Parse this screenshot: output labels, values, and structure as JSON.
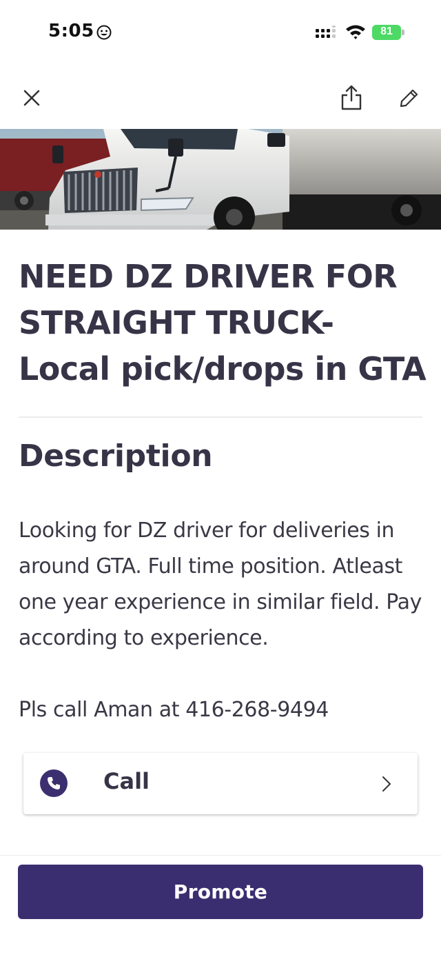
{
  "status_bar": {
    "time": "5:05",
    "battery_level": "81",
    "icons": [
      "emoji-face-icon",
      "cellular-signal-icon",
      "wifi-icon",
      "battery-charging-icon"
    ]
  },
  "nav": {
    "icons": [
      "close-icon",
      "share-icon",
      "edit-pencil-icon"
    ]
  },
  "listing": {
    "title": "NEED DZ DRIVER FOR STRAIGHT TRUCK- Local pick/drops in GTA",
    "description_heading": "Description",
    "description": "Looking for DZ driver for deliveries in around GTA. Full time position. Atleast one year experience in similar field. Pay according to experience.",
    "contact": "Pls call Aman at 416-268-9494"
  },
  "call_action": {
    "label": "Call",
    "icons": [
      "phone-icon",
      "chevron-right-icon"
    ]
  },
  "footer": {
    "promote_label": "Promote"
  },
  "colors": {
    "brand_purple": "#3b2e70",
    "text_dark": "#373447",
    "battery_green": "#4cd964"
  }
}
